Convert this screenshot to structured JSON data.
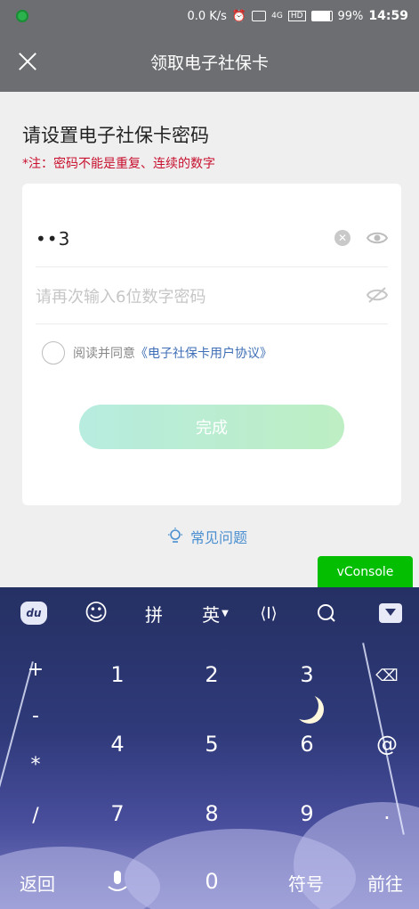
{
  "status_bar": {
    "network_speed": "0.0 K/s",
    "battery": "99%",
    "time": "14:59",
    "signal_label": "4G",
    "hd_label": "HD"
  },
  "navbar": {
    "title": "领取电子社保卡"
  },
  "page": {
    "heading": "请设置电子社保卡密码",
    "note": "*注：密码不能是重复、连续的数字",
    "password_value": "••3",
    "confirm_placeholder": "请再次输入6位数字密码",
    "agree_text": "阅读并同意",
    "agree_link": "《电子社保卡用户协议》",
    "done_button": "完成",
    "faq_link": "常见问题",
    "vconsole": "vConsole"
  },
  "keyboard": {
    "toolbar": [
      "du",
      "☺",
      "拼",
      "英",
      "⟨I⟩",
      "search",
      "hide"
    ],
    "lang_label": "英",
    "pinyin_label": "拼",
    "left_symbols": [
      "+",
      "-",
      "*",
      "/"
    ],
    "keys": [
      "1",
      "2",
      "3",
      "4",
      "5",
      "6",
      "7",
      "8",
      "9",
      "0"
    ],
    "right_symbols": [
      "@",
      "."
    ],
    "back_label": "返回",
    "symbols_label": "符号",
    "go_label": "前往"
  },
  "colors": {
    "header": "#6c6e71",
    "note_red": "#c8102e",
    "link_blue": "#3f6fb6",
    "vconsole_green": "#04be02"
  }
}
